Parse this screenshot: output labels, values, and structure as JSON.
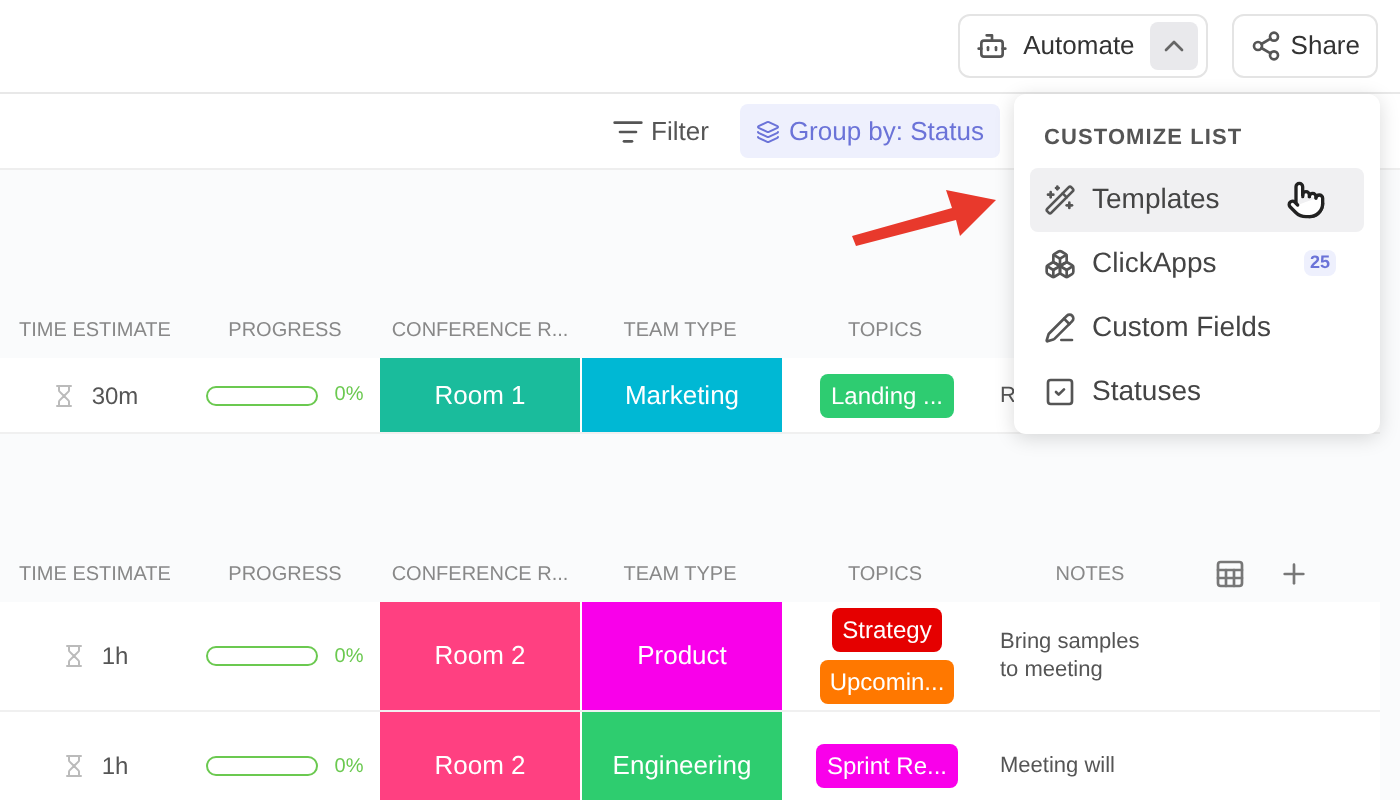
{
  "header": {
    "automate": {
      "label": "Automate",
      "expanded": true
    },
    "share": {
      "label": "Share"
    }
  },
  "toolbar": {
    "filter": "Filter",
    "group_by": "Group by: Status"
  },
  "groups": [
    {
      "columns": [
        "TIME ESTIMATE",
        "PROGRESS",
        "CONFERENCE R...",
        "TEAM TYPE",
        "TOPICS"
      ],
      "rows": [
        {
          "time": "30m",
          "progress": {
            "level": 0,
            "reading": "0%"
          },
          "room": {
            "text": "Room 1",
            "color": "#1abc9c"
          },
          "team": {
            "text": "Marketing",
            "color": "#00b8d4"
          },
          "topics": [
            {
              "text": "Landing ...",
              "color": "#2ecc71"
            }
          ],
          "notes": "R"
        }
      ]
    },
    {
      "columns": [
        "TIME ESTIMATE",
        "PROGRESS",
        "CONFERENCE R...",
        "TEAM TYPE",
        "TOPICS",
        "NOTES"
      ],
      "header_actions": true,
      "rows": [
        {
          "time": "1h",
          "progress": {
            "level": 0,
            "reading": "0%"
          },
          "room": {
            "text": "Room 2",
            "color": "#ff4081"
          },
          "team": {
            "text": "Product",
            "color": "#f900ea"
          },
          "topics": [
            {
              "text": "Strategy",
              "color": "#e50000"
            },
            {
              "text": "Upcomin...",
              "color": "#ff7800"
            }
          ],
          "notes": "Bring samples to meeting"
        },
        {
          "time": "1h",
          "progress": {
            "level": 0,
            "reading": "0%"
          },
          "room": {
            "text": "Room 2",
            "color": "#ff4081"
          },
          "team": {
            "text": "Engineering",
            "color": "#2ecd6f"
          },
          "topics": [
            {
              "text": "Sprint Re...",
              "color": "#f900ea"
            }
          ],
          "notes": "Meeting will"
        }
      ]
    }
  ],
  "menu": {
    "title": "CUSTOMIZE LIST",
    "items": [
      {
        "kind": "templates",
        "label": "Templates",
        "selected": true
      },
      {
        "kind": "clickapps",
        "label": "ClickApps",
        "badge": "25",
        "selected": false
      },
      {
        "kind": "fields",
        "label": "Custom Fields",
        "selected": false
      },
      {
        "kind": "statuses",
        "label": "Statuses",
        "selected": false
      }
    ]
  }
}
